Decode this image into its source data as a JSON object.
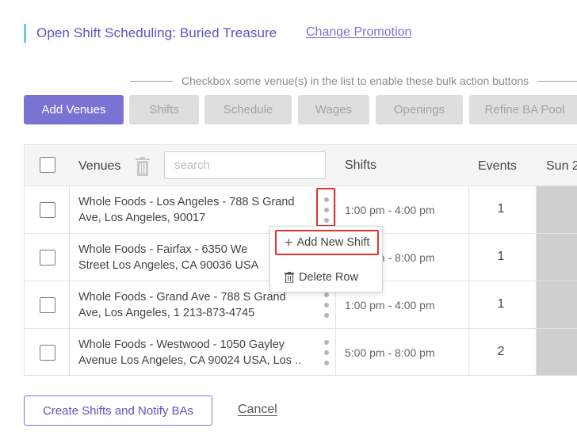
{
  "header": {
    "title": "Open Shift Scheduling: Buried Treasure",
    "change_link": "Change Promotion"
  },
  "hint": "Checkbox some venue(s) in the list to enable these bulk action buttons",
  "toolbar": {
    "add_venues": "Add Venues",
    "shifts": "Shifts",
    "schedule": "Schedule",
    "wages": "Wages",
    "openings": "Openings",
    "refine_pool": "Refine BA Pool"
  },
  "table": {
    "headers": {
      "venues": "Venues",
      "search_placeholder": "search",
      "shifts": "Shifts",
      "events": "Events",
      "sun": "Sun 2"
    },
    "rows": [
      {
        "venue_line1": "Whole Foods - Los Angeles - 788 S Grand",
        "venue_line2": "Ave, Los Angeles, 90017",
        "shift": "1:00 pm - 4:00 pm",
        "events": "1"
      },
      {
        "venue_line1": "Whole Foods - Fairfax - 6350 We",
        "venue_line2": "Street Los Angeles, CA 90036 USA",
        "shift": "5:00 pm - 8:00 pm",
        "events": "1"
      },
      {
        "venue_line1": "Whole Foods - Grand Ave - 788 S Grand",
        "venue_line2": "Ave, Los Angeles, 1 213-873-4745",
        "shift": "1:00 pm - 4:00 pm",
        "events": "1"
      },
      {
        "venue_line1": "Whole Foods - Westwood - 1050 Gayley",
        "venue_line2": "Avenue Los Angeles, CA 90024 USA, Los ...",
        "shift": "5:00 pm - 8:00 pm",
        "events": "2"
      }
    ]
  },
  "row_menu": {
    "add_shift": "Add New Shift",
    "delete_row": "Delete Row"
  },
  "footer": {
    "create_button": "Create Shifts and Notify BAs",
    "cancel": "Cancel"
  },
  "colors": {
    "accent": "#7b73d3",
    "title": "#5a55c0",
    "highlight": "#e0342d"
  }
}
